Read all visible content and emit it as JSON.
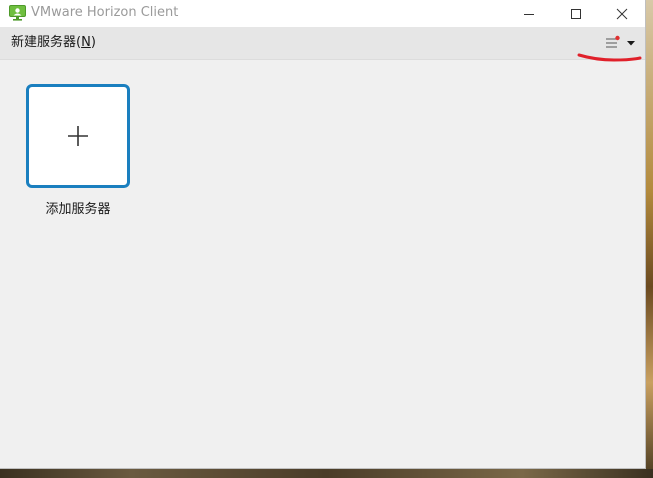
{
  "window": {
    "title": "VMware Horizon Client"
  },
  "menubar": {
    "new_server_text": "新建服务器",
    "new_server_open": "(",
    "new_server_key": "N",
    "new_server_close": ")",
    "options_icon": "hamburger-menu-icon",
    "notification_dot_color": "#e03030"
  },
  "content": {
    "add_server_label": "添加服务器",
    "add_server_icon": "plus-icon",
    "tile_border_color": "#1a7fbf"
  },
  "colors": {
    "annotation_red": "#e0202a"
  }
}
